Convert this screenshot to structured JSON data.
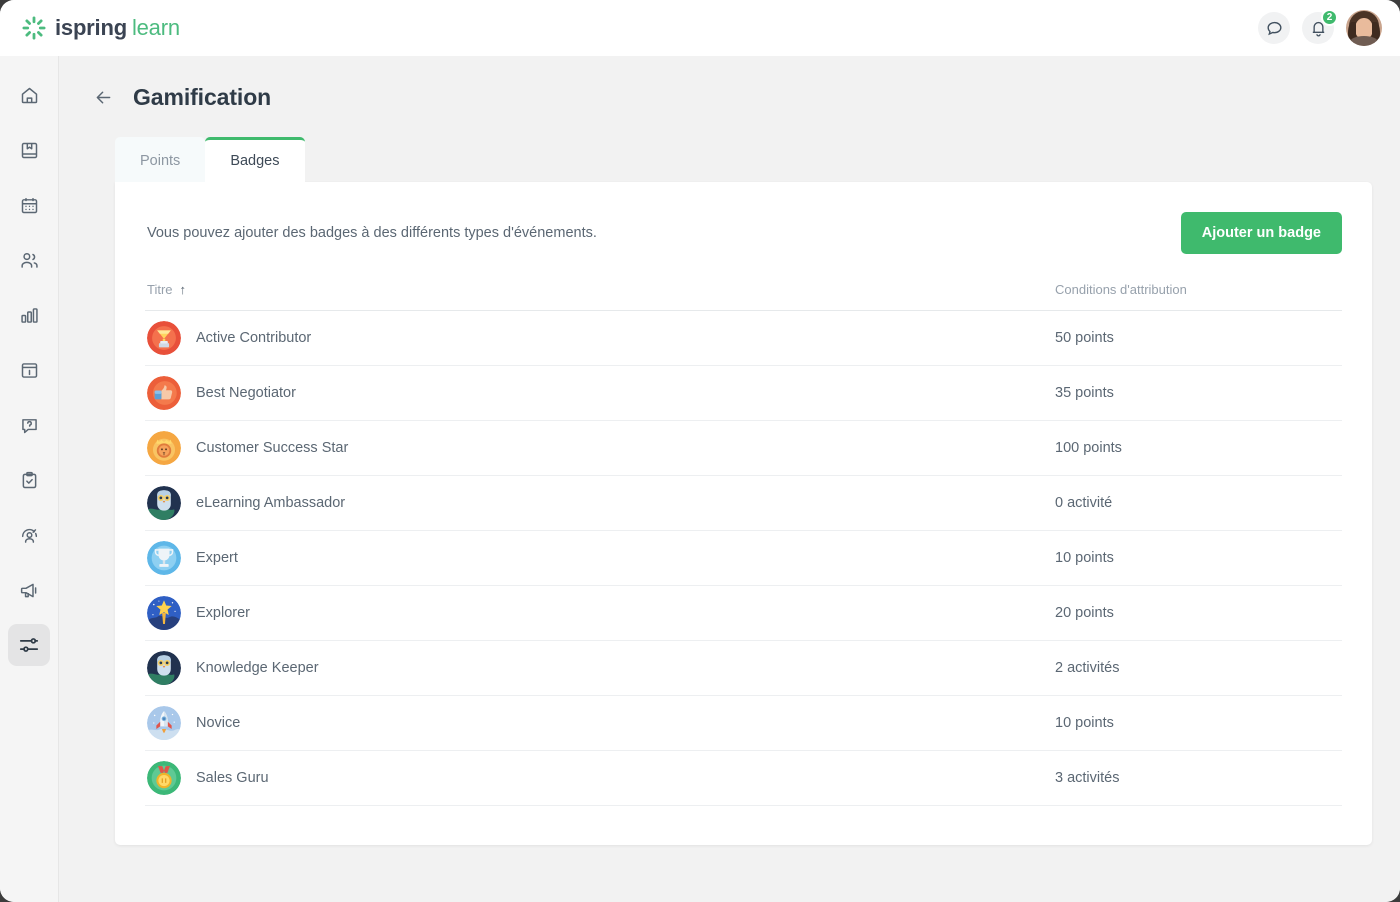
{
  "brand": {
    "name_a": "ispring",
    "name_b": "learn",
    "logo_icon": "ispring-sunburst-icon"
  },
  "topbar": {
    "chat_icon": "chat-bubble-icon",
    "bell_icon": "bell-icon",
    "notification_count": "2",
    "avatar_icon": "user-avatar"
  },
  "sidebar": {
    "items": [
      {
        "icon": "home-icon",
        "active": false
      },
      {
        "icon": "book-icon",
        "active": false
      },
      {
        "icon": "calendar-icon",
        "active": false
      },
      {
        "icon": "users-icon",
        "active": false
      },
      {
        "icon": "bar-chart-icon",
        "active": false
      },
      {
        "icon": "info-panel-icon",
        "active": false
      },
      {
        "icon": "question-bubble-icon",
        "active": false
      },
      {
        "icon": "clipboard-check-icon",
        "active": false
      },
      {
        "icon": "user-performance-icon",
        "active": false
      },
      {
        "icon": "megaphone-icon",
        "active": false
      },
      {
        "icon": "settings-sliders-icon",
        "active": true
      }
    ]
  },
  "header": {
    "back_icon": "arrow-left-icon",
    "title": "Gamification"
  },
  "tabs": [
    {
      "label": "Points",
      "active": false
    },
    {
      "label": "Badges",
      "active": true
    }
  ],
  "content": {
    "intro": "Vous pouvez ajouter des badges à des différents types d'événements.",
    "add_button": "Ajouter un badge",
    "columns": {
      "title": "Titre",
      "sort_arrow": "↑",
      "conditions": "Conditions d'attribution"
    },
    "rows": [
      {
        "icon": "trophy-badge-icon",
        "icon_bg": "#e8503a",
        "title": "Active Contributor",
        "condition": "50 points"
      },
      {
        "icon": "thumbsup-badge-icon",
        "icon_bg": "#ec5f3a",
        "title": "Best Negotiator",
        "condition": "35 points"
      },
      {
        "icon": "lion-badge-icon",
        "icon_bg": "#f5a742",
        "title": "Customer Success Star",
        "condition": "100 points"
      },
      {
        "icon": "owl-badge-icon",
        "icon_bg": "#21324f",
        "title": "eLearning Ambassador",
        "condition": "0 activité"
      },
      {
        "icon": "cup-badge-icon",
        "icon_bg": "#5eb7e8",
        "title": "Expert",
        "condition": "10 points"
      },
      {
        "icon": "star-badge-icon",
        "icon_bg": "#2f5fc4",
        "title": "Explorer",
        "condition": "20 points"
      },
      {
        "icon": "owl-badge-icon",
        "icon_bg": "#21324f",
        "title": "Knowledge Keeper",
        "condition": "2 activités"
      },
      {
        "icon": "rocket-badge-icon",
        "icon_bg": "#a9c8ea",
        "title": "Novice",
        "condition": "10 points"
      },
      {
        "icon": "medal-badge-icon",
        "icon_bg": "#3cb878",
        "title": "Sales Guru",
        "condition": "3 activités"
      }
    ]
  },
  "colors": {
    "accent": "#3fba6d",
    "text": "#5b6773",
    "muted": "#97a1ac",
    "page_bg": "#f2f2f2"
  }
}
